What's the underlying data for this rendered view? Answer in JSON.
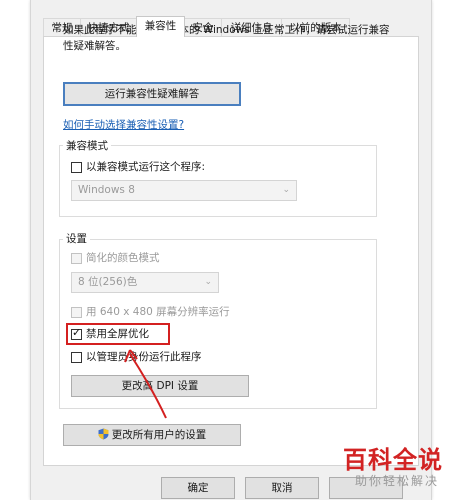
{
  "tabs": [
    "常规",
    "快捷方式",
    "兼容性",
    "安全",
    "详细信息",
    "以前的版本"
  ],
  "active_tab": "兼容性",
  "description": "如果此程序不能在这个版本的 Windows 上正常工作，请尝试运行兼容性疑难解答。",
  "troubleshoot_button": "运行兼容性疑难解答",
  "manual_link": "如何手动选择兼容性设置?",
  "compat_mode": {
    "group_label": "兼容模式",
    "checkbox_label": "以兼容模式运行这个程序:",
    "checked": false,
    "os_select": "Windows 8"
  },
  "settings": {
    "group_label": "设置",
    "reduced_color": {
      "label": "简化的颜色模式",
      "checked": false,
      "disabled": true
    },
    "color_select": "8 位(256)色",
    "res_640": {
      "label": "用 640 x 480 屏幕分辨率运行",
      "checked": false,
      "disabled": true
    },
    "disable_fullscreen": {
      "label": "禁用全屏优化",
      "checked": true
    },
    "run_as_admin": {
      "label": "以管理员身份运行此程序",
      "checked": false
    },
    "dpi_button": "更改高 DPI 设置"
  },
  "all_users_button": "更改所有用户的设置",
  "footer": {
    "ok": "确定",
    "cancel": "取消"
  },
  "watermark": {
    "title": "百科全说",
    "subtitle": "助你轻松解决"
  },
  "colors": {
    "highlight": "#d42020",
    "link": "#1a5fb4",
    "watermark": "#d22323"
  }
}
